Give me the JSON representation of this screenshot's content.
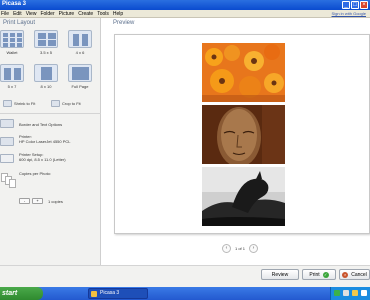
{
  "window": {
    "title": "Picasa 3"
  },
  "menubar": {
    "items": [
      "File",
      "Edit",
      "View",
      "Folder",
      "Picture",
      "Create",
      "Tools",
      "Help"
    ],
    "signin": "Sign in with Google"
  },
  "left_panel": {
    "title": "Print Layout",
    "layouts": [
      {
        "label": "Wallet"
      },
      {
        "label": "3.5 x 5"
      },
      {
        "label": "4 x 6"
      },
      {
        "label": "5 x 7"
      },
      {
        "label": "8 x 10"
      },
      {
        "label": "Full Page"
      }
    ],
    "fit": {
      "shrink": "Shrink to Fit",
      "crop": "Crop to Fit"
    },
    "border": {
      "label": "Border and Text Options"
    },
    "printer": {
      "heading": "Printer:",
      "value": "HP Color LaserJet 4550 PCL"
    },
    "setup": {
      "heading": "Printer Setup:",
      "value": "600 dpi, 8.5 x 11.0 (Letter)"
    },
    "copies": {
      "heading": "Copies per Photo:",
      "minus": "-",
      "plus": "+",
      "value": "1 copies"
    }
  },
  "preview": {
    "title": "Preview",
    "page_indicator": "1 of 1"
  },
  "actions": {
    "review": "Review",
    "print": "Print",
    "cancel": "Cancel"
  },
  "taskbar": {
    "start": "start",
    "item": "Picasa 3"
  },
  "colors": {
    "titlebar": "#0a4bcf",
    "start": "#3a9a3a",
    "accent": "#5b6f8c"
  }
}
